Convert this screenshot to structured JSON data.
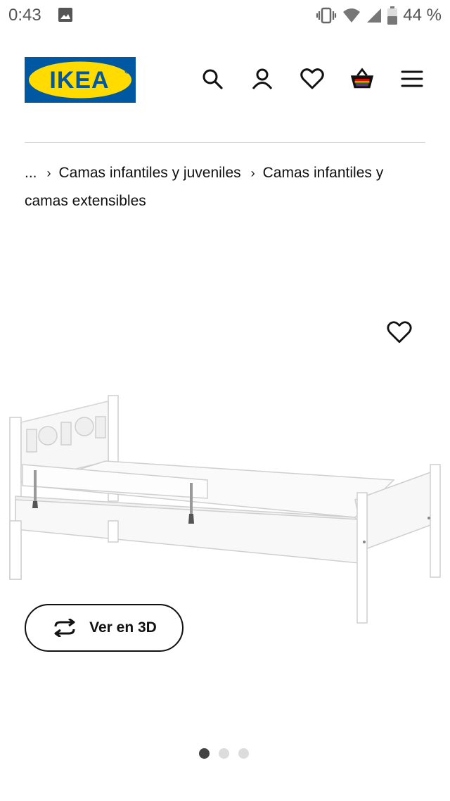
{
  "status_bar": {
    "time": "0:43",
    "battery": "44 %",
    "icons": [
      "image-icon",
      "vibrate-icon",
      "wifi-icon",
      "signal-icon",
      "battery-icon"
    ]
  },
  "header": {
    "logo_text": "IKEA",
    "icons": [
      "search-icon",
      "account-icon",
      "wishlist-heart-icon",
      "shopping-bag-icon",
      "menu-icon"
    ],
    "brand_colors": {
      "blue": "#0058A3",
      "yellow": "#FFDB00"
    }
  },
  "breadcrumb": {
    "ellipsis": "...",
    "items": [
      "Camas infantiles y juveniles",
      "Camas infantiles y camas extensibles"
    ]
  },
  "product": {
    "favorite_icon": "heart-outline-icon",
    "view_3d_label": "Ver en 3D",
    "view_3d_icon": "rotate-arrows-icon"
  },
  "gallery": {
    "total_images": 3,
    "active_index": 0
  }
}
